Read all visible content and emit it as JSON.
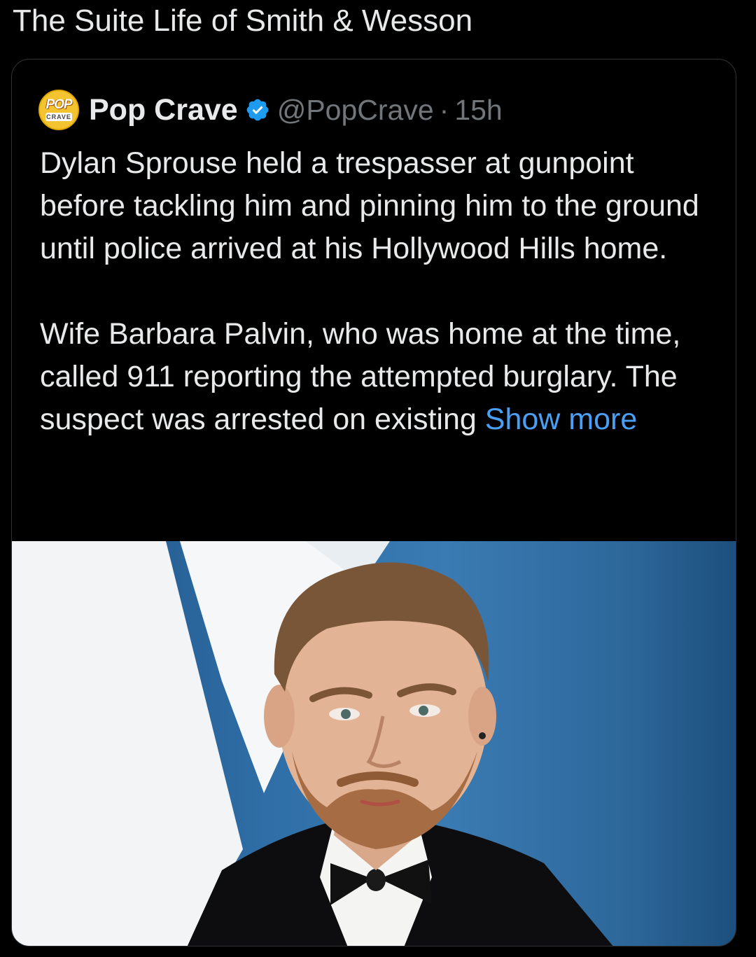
{
  "caption": "The Suite Life of Smith & Wesson",
  "tweet": {
    "avatar": {
      "top": "POP",
      "bottom": "CRAVE",
      "icon": "pop-crave-logo"
    },
    "author_name": "Pop Crave",
    "verified_icon": "verified-badge-icon",
    "handle": "@PopCrave",
    "separator": "·",
    "time": "15h",
    "paragraph_1": "Dylan Sprouse held a trespasser at gunpoint before tackling him and pinning him to the ground until police arrived at his Hollywood Hills home.",
    "paragraph_2": "Wife Barbara Palvin, who was home at the time, called 911 reporting the attempted burglary. The suspect was arrested on existing",
    "show_more": "Show more",
    "photo_icon": "portrait-photo"
  },
  "colors": {
    "background": "#000000",
    "text": "#e7e9ea",
    "secondary_text": "#71767b",
    "link": "#4a9ff5",
    "verified": "#1d9bf0"
  }
}
